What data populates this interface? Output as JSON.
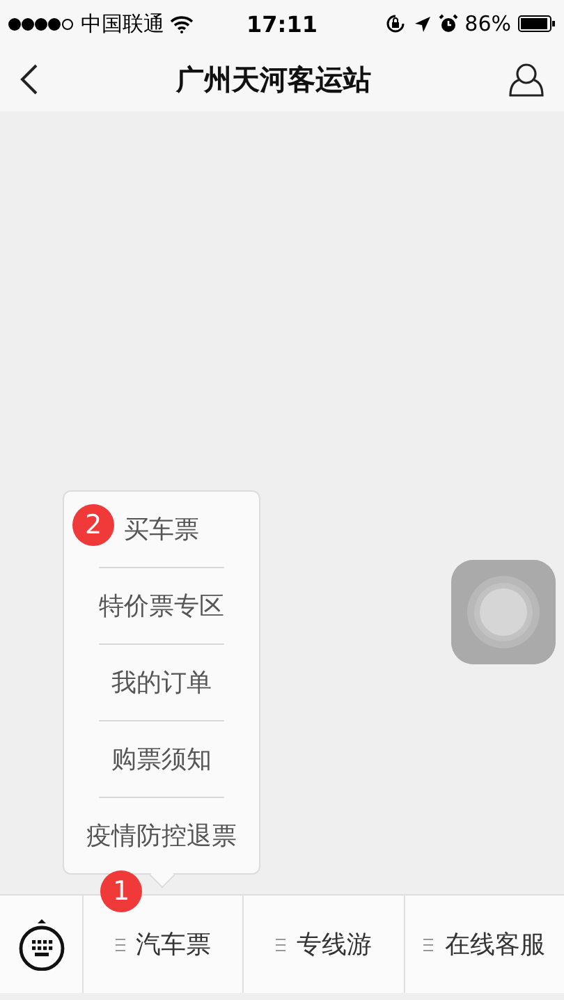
{
  "status_bar": {
    "carrier": "中国联通",
    "time": "17:11",
    "battery": "86%"
  },
  "nav_bar": {
    "title": "广州天河客运站"
  },
  "bottom_menu": [
    {
      "label": "汽车票",
      "submenu": [
        "买车票",
        "特价票专区",
        "我的订单",
        "购票须知",
        "疫情防控退票"
      ]
    },
    {
      "label": "专线游"
    },
    {
      "label": "在线客服"
    }
  ],
  "annotations": [
    {
      "text": "2"
    },
    {
      "text": "1"
    }
  ]
}
